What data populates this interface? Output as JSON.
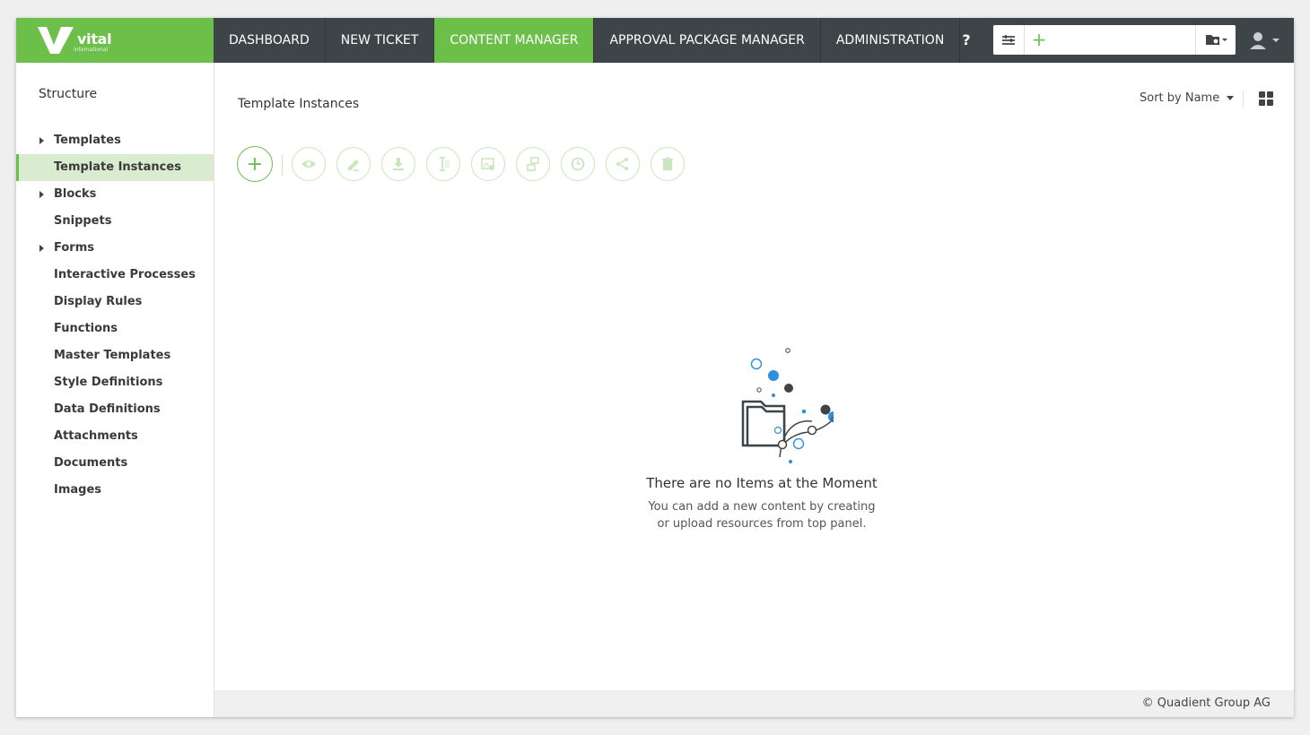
{
  "brand": {
    "name": "vital",
    "sub": "international",
    "accent": "#6cc04a",
    "dark": "#3d4549"
  },
  "nav": [
    {
      "label": "DASHBOARD",
      "active": false
    },
    {
      "label": "NEW TICKET",
      "active": false
    },
    {
      "label": "CONTENT MANAGER",
      "active": true
    },
    {
      "label": "APPROVAL PACKAGE MANAGER",
      "active": false
    },
    {
      "label": "ADMINISTRATION",
      "active": false
    }
  ],
  "help_label": "?",
  "search": {
    "plus": "+",
    "placeholder": "",
    "value": ""
  },
  "sidebar": {
    "title": "Structure",
    "items": [
      {
        "label": "Templates",
        "expandable": true
      },
      {
        "label": "Template Instances",
        "active": true
      },
      {
        "label": "Blocks",
        "expandable": true
      },
      {
        "label": "Snippets"
      },
      {
        "label": "Forms",
        "expandable": true
      },
      {
        "label": "Interactive Processes"
      },
      {
        "label": "Display Rules"
      },
      {
        "label": "Functions"
      },
      {
        "label": "Master Templates"
      },
      {
        "label": "Style Definitions"
      },
      {
        "label": "Data Definitions"
      },
      {
        "label": "Attachments"
      },
      {
        "label": "Documents"
      },
      {
        "label": "Images"
      }
    ]
  },
  "main": {
    "title": "Template Instances",
    "sort_label": "Sort by Name",
    "add_label": "+",
    "toolbar_icons": [
      "eye-icon",
      "edit-icon",
      "download-icon",
      "text-cursor-icon",
      "image-settings-icon",
      "duplicate-icon",
      "clock-icon",
      "share-icon",
      "trash-icon"
    ]
  },
  "empty": {
    "title": "There are no Items at the Moment",
    "line1": "You can add a new content by creating",
    "line2": "or upload resources from top panel."
  },
  "footer": {
    "copyright": "© Quadient Group AG"
  }
}
